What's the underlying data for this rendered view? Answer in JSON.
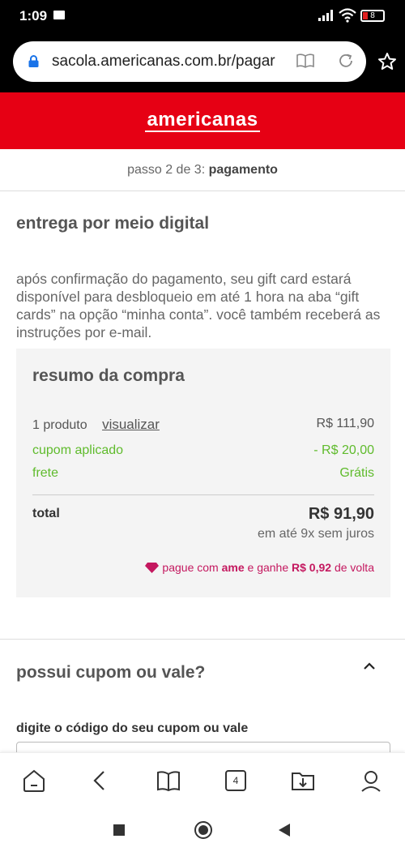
{
  "status": {
    "time": "1:09",
    "battery": "8"
  },
  "browser": {
    "url": "sacola.americanas.com.br/pagar"
  },
  "brand": {
    "logo": "americanas"
  },
  "stepper": {
    "prefix": "passo 2 de 3:",
    "step": "pagamento"
  },
  "delivery": {
    "title": "entrega por meio digital",
    "text": "após confirmação do pagamento, seu gift card estará disponível para desbloqueio em até 1 hora na aba “gift cards” na opção “minha conta”. você também receberá as instruções por e-mail."
  },
  "summary": {
    "title": "resumo da compra",
    "product_label": "1 produto",
    "view_link": "visualizar",
    "product_price": "R$ 111,90",
    "coupon_label": "cupom aplicado",
    "coupon_value": "- R$ 20,00",
    "shipping_label": "frete",
    "shipping_value": "Grátis",
    "total_label": "total",
    "total_value": "R$ 91,90",
    "installments": "em até 9x sem juros",
    "ame": {
      "p1": "pague com ",
      "brand": "ame",
      "p2": " e ganhe ",
      "amount": "R$ 0,92",
      "p3": " de volta"
    }
  },
  "coupon": {
    "title": "possui cupom ou vale?",
    "input_label": "digite o código do seu cupom ou vale",
    "input_value": ""
  },
  "nav": {
    "tabs_count": "4"
  },
  "colors": {
    "brand_red": "#e60014",
    "green": "#5fbb2c",
    "ame_pink": "#c4185f"
  }
}
